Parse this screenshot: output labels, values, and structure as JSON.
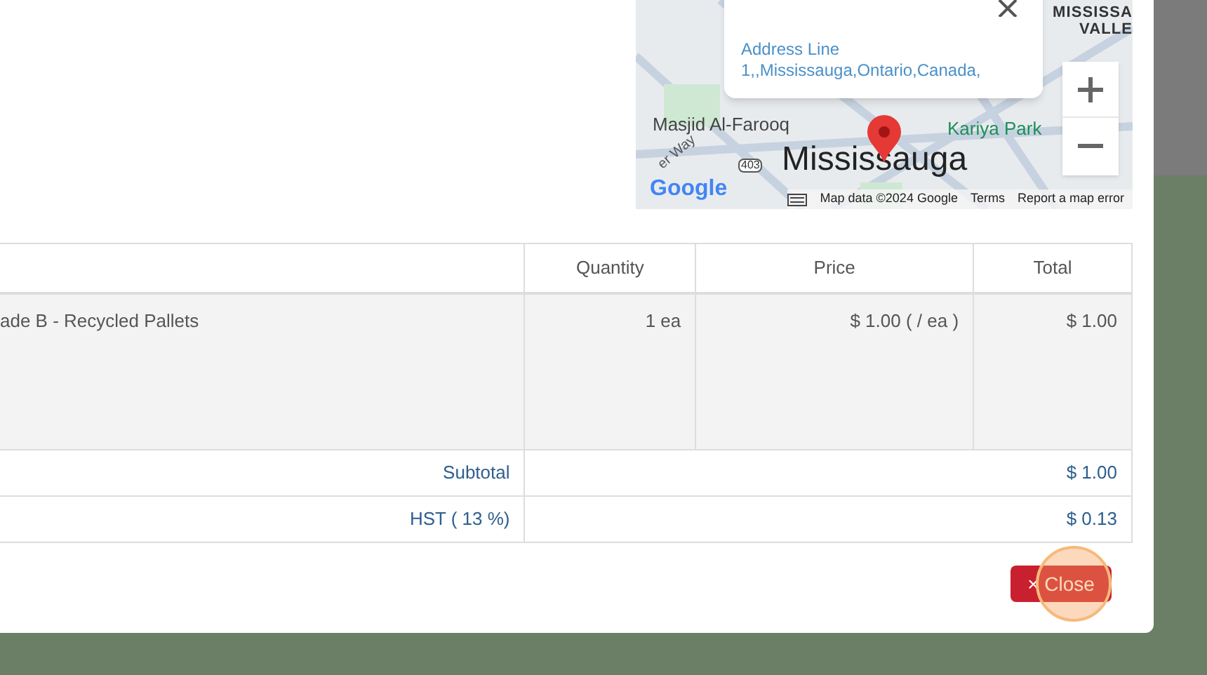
{
  "map": {
    "popup": {
      "text": "Address Line 1,,Mississauga,Ontario,Canada,"
    },
    "labels": [
      {
        "kind": "area",
        "text": "MISSISSA"
      },
      {
        "kind": "area",
        "text": "VALLE"
      },
      {
        "kind": "place",
        "text": "Masjid Al-Farooq"
      },
      {
        "kind": "park",
        "text": "Kariya Park"
      },
      {
        "kind": "road",
        "text": "er Way"
      },
      {
        "kind": "shield",
        "text": "403"
      },
      {
        "kind": "city",
        "text": "Mississauga"
      }
    ],
    "logo": "Google",
    "attribution": [
      "Map data ©2024 Google",
      "Terms",
      "Report a map error"
    ]
  },
  "table": {
    "columns": [
      "",
      "Quantity",
      "Price",
      "Total"
    ],
    "rows": [
      {
        "cells": [
          "ade B - Recycled Pallets",
          "1 ea",
          "$ 1.00 ( / ea )",
          "$ 1.00"
        ]
      }
    ],
    "summary": [
      {
        "label": "Subtotal",
        "value": "$ 1.00"
      },
      {
        "label": "HST ( 13 %)",
        "value": "$ 0.13"
      }
    ]
  },
  "footer": {
    "close_button": "× Close"
  }
}
